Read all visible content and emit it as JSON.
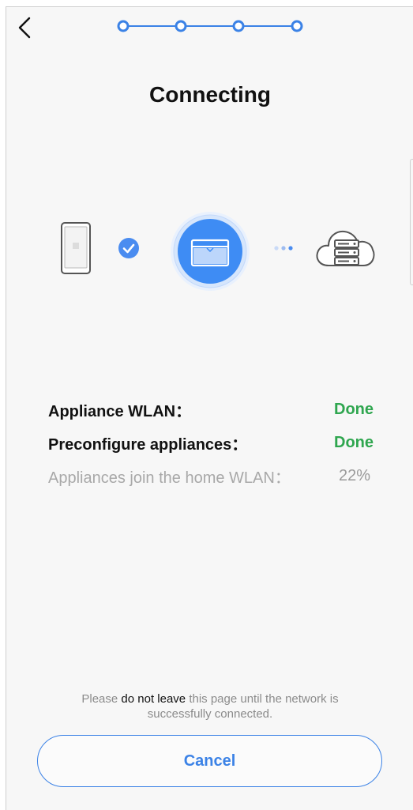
{
  "header": {
    "back_icon": "chevron-left-icon",
    "steps_total": 4,
    "accent_color": "#3b82e6"
  },
  "page": {
    "title": "Connecting"
  },
  "diagram": {
    "icons": [
      "phone-icon",
      "check-icon",
      "router-icon",
      "dots-icon",
      "cloud-server-icon"
    ]
  },
  "status": {
    "items": [
      {
        "label": "Appliance WLAN：",
        "value": "Done"
      },
      {
        "label": "Preconfigure appliances：",
        "value": "Done"
      },
      {
        "label": "Appliances join the home WLAN：",
        "value": "22%"
      }
    ],
    "done_color": "#2fa64f"
  },
  "notice": {
    "prefix": "Please ",
    "emphasis": "do not leave",
    "suffix": " this page until the network is successfully connected."
  },
  "actions": {
    "cancel_label": "Cancel"
  }
}
